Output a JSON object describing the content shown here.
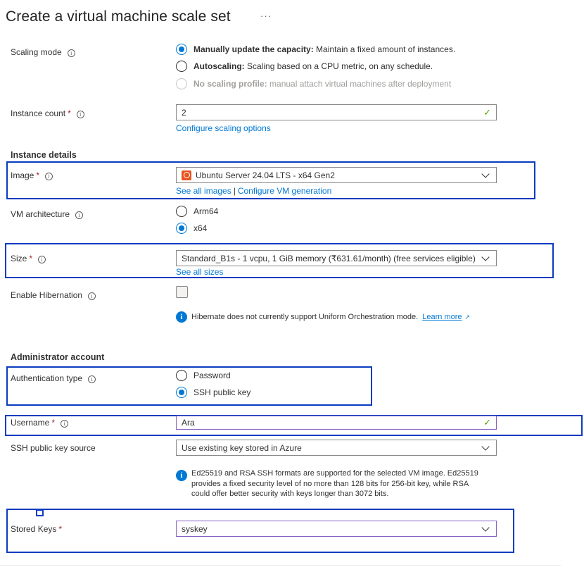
{
  "page": {
    "title": "Create a virtual machine scale set",
    "more": "···"
  },
  "scaling": {
    "label": "Scaling mode",
    "options": [
      {
        "bold": "Manually update the capacity:",
        "text": " Maintain a fixed amount of instances.",
        "selected": true
      },
      {
        "bold": "Autoscaling:",
        "text": " Scaling based on a CPU metric, on any schedule.",
        "selected": false
      },
      {
        "bold": "No scaling profile:",
        "text": " manual attach virtual machines after deployment",
        "selected": false,
        "disabled": true
      }
    ]
  },
  "instance_count": {
    "label": "Instance count",
    "value": "2",
    "link": "Configure scaling options"
  },
  "instance_details": {
    "heading": "Instance details"
  },
  "image": {
    "label": "Image",
    "value": "Ubuntu Server 24.04 LTS - x64 Gen2",
    "link1": "See all images",
    "link2": "Configure VM generation"
  },
  "vm_arch": {
    "label": "VM architecture",
    "options": [
      "Arm64",
      "x64"
    ],
    "selected": "x64"
  },
  "size": {
    "label": "Size",
    "value": "Standard_B1s - 1 vcpu, 1 GiB memory (₹631.61/month) (free services eligible)",
    "link": "See all sizes"
  },
  "hibernation": {
    "label": "Enable Hibernation",
    "note": "Hibernate does not currently support Uniform Orchestration mode.",
    "link": "Learn more"
  },
  "admin": {
    "heading": "Administrator account"
  },
  "auth_type": {
    "label": "Authentication type",
    "options": [
      "Password",
      "SSH public key"
    ],
    "selected": "SSH public key"
  },
  "username": {
    "label": "Username",
    "value": "Ara"
  },
  "ssh_source": {
    "label": "SSH public key source",
    "value": "Use existing key stored in Azure",
    "note_lines": [
      "Ed25519 and RSA SSH formats are supported for the selected VM image. Ed25519",
      "provides a fixed security level of no more than 128 bits for 256-bit key, while RSA",
      "could offer better security with keys longer than 3072 bits."
    ]
  },
  "stored_keys": {
    "label": "Stored Keys",
    "value": "syskey"
  },
  "colors": {
    "accent": "#0078d4",
    "highlight_box": "#0a3cbf",
    "required": "#a4262c",
    "valid": "#57a300"
  }
}
